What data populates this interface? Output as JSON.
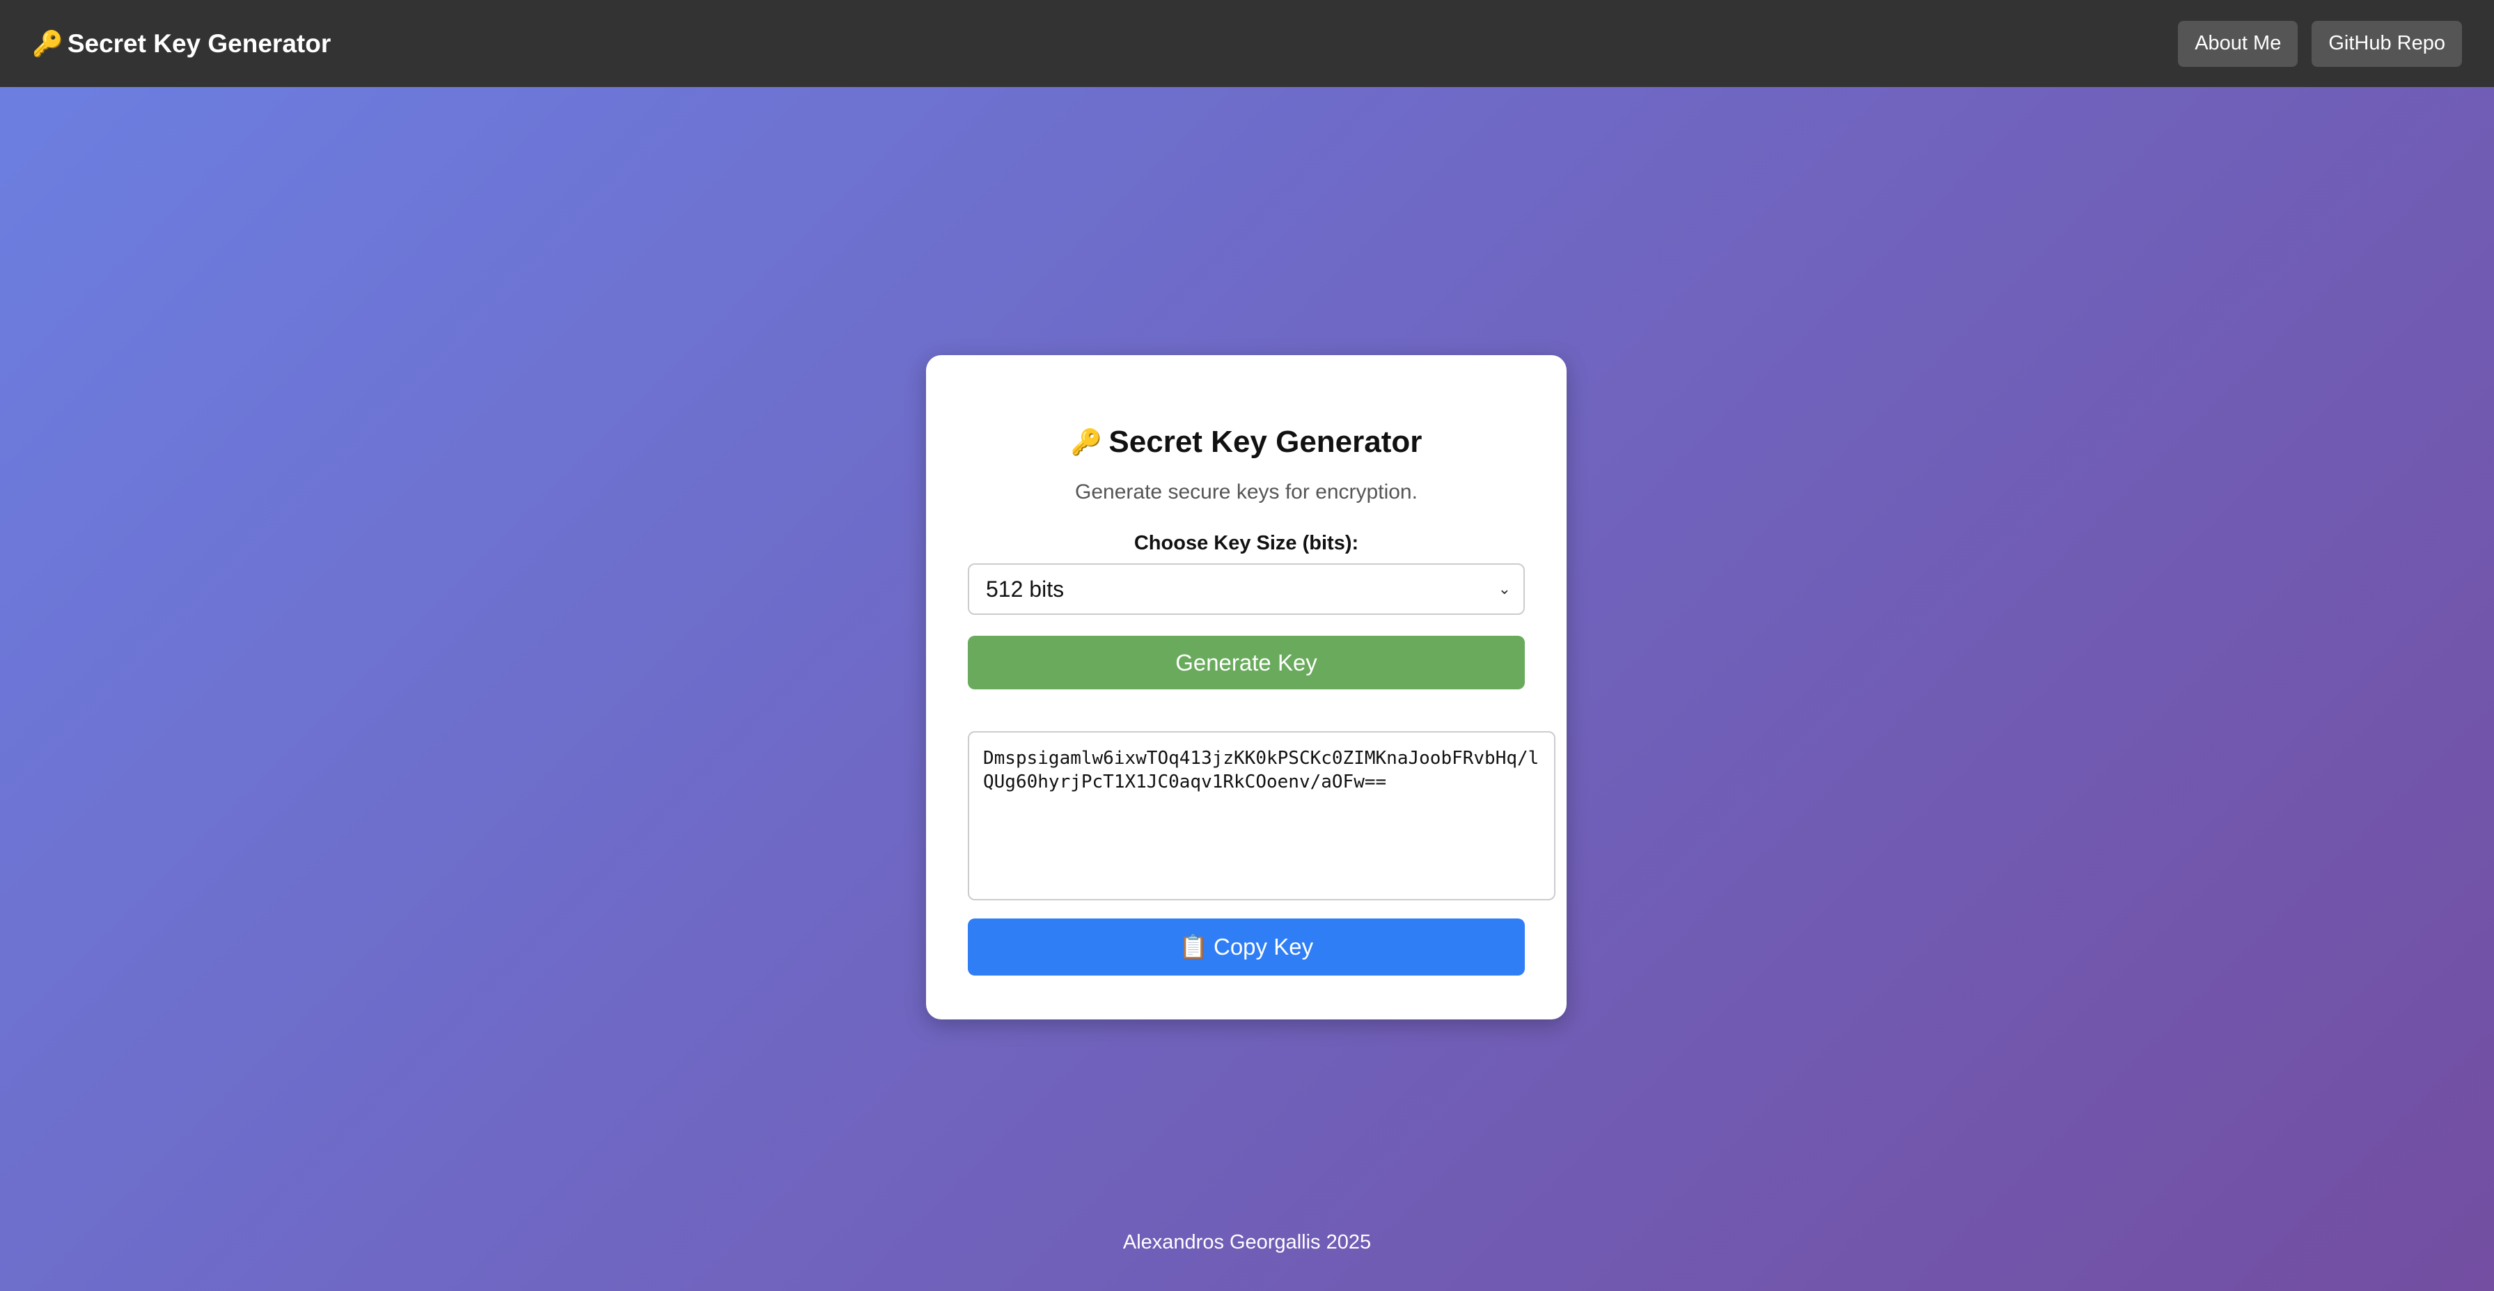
{
  "navbar": {
    "brand_icon": "🔑",
    "brand_title": "Secret Key Generator",
    "links": [
      {
        "label": "About Me"
      },
      {
        "label": "GitHub Repo"
      }
    ]
  },
  "card": {
    "title_icon": "🔑",
    "title": "Secret Key Generator",
    "subtitle": "Generate secure keys for encryption.",
    "key_size_label": "Choose Key Size (bits):",
    "key_size_selected": "512 bits",
    "generate_label": "Generate Key",
    "generated_key": "Dmspsigamlw6ixwTOq413jzKK0kPSCKc0ZIMKnaJoobFRvbHq/lQUg60hyrjPcT1X1JC0aqv1RkCOoenv/aOFw==",
    "copy_icon": "📋",
    "copy_label": "Copy Key"
  },
  "footer": {
    "text": "Alexandros Georgallis 2025"
  },
  "colors": {
    "navbar_bg": "#333333",
    "generate_button": "#69aa5c",
    "copy_button": "#2f7ef5",
    "gradient_start": "#6c80e2",
    "gradient_end": "#734ea1"
  }
}
